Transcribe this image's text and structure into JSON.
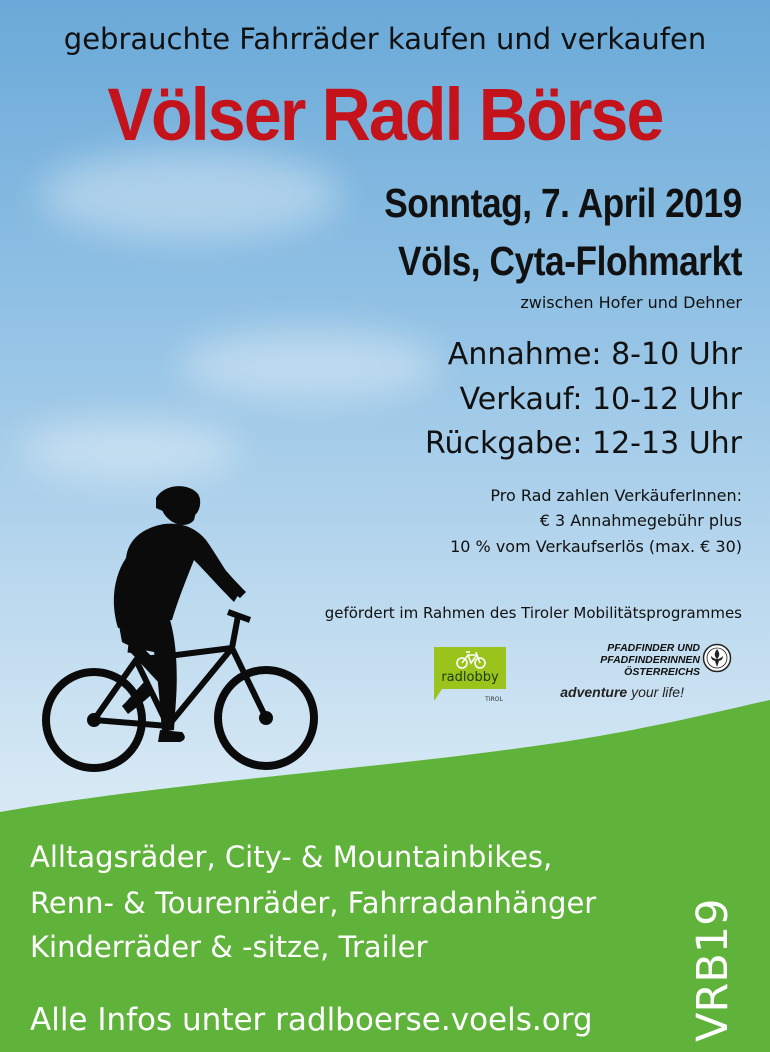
{
  "header": {
    "subtitle": "gebrauchte Fahrräder kaufen und verkaufen",
    "title": "Völser Radl Börse"
  },
  "event": {
    "date": "Sonntag, 7. April 2019",
    "place": "Völs, Cyta-Flohmarkt",
    "location_note": "zwischen Hofer und Dehner"
  },
  "schedule": [
    "Annahme: 8-10 Uhr",
    "Verkauf: 10-12 Uhr",
    "Rückgabe: 12-13 Uhr"
  ],
  "fees": [
    "Pro Rad zahlen VerkäuferInnen:",
    "€ 3 Annahmegebühr plus",
    "10 % vom Verkaufserlös (max. € 30)"
  ],
  "funding_note": "gefördert im Rahmen des Tiroler Mobilitätsprogrammes",
  "sponsors": {
    "radlobby_name": "radlobby",
    "radlobby_region": "TIROL",
    "pfadi_line1": "PFADFINDER UND",
    "pfadi_line2": "PFADFINDERINNEN",
    "pfadi_line3": "ÖSTERREICHS",
    "pfadi_slogan_bold": "adventure",
    "pfadi_slogan_rest": " your life!"
  },
  "categories": [
    "Alltagsräder, City- & Mountainbikes,",
    "Renn- & Tourenräder, Fahrradanhänger",
    "Kinderräder & -sitze, Trailer"
  ],
  "info": "Alle Infos unter radlboerse.voels.org",
  "code": "VRB19",
  "colors": {
    "title_red": "#c4131b",
    "hill_green": "#5fb33a",
    "radlobby_green": "#9ac31c",
    "sky_blue": "#6aa9d8"
  }
}
